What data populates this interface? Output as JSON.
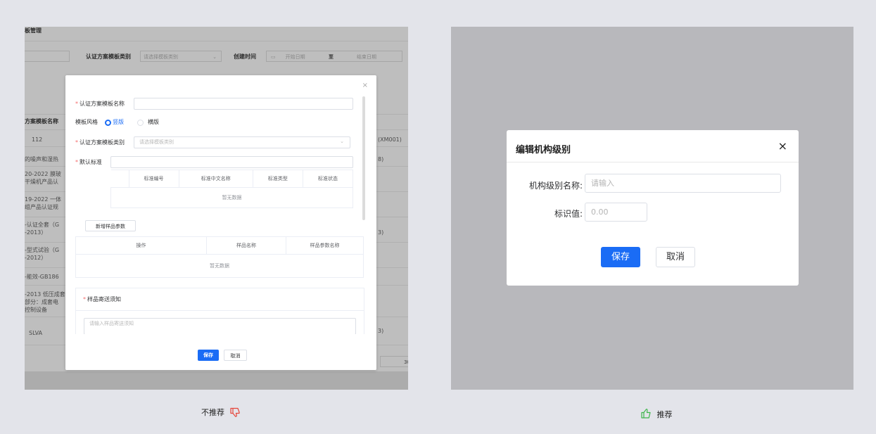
{
  "left_bg": {
    "page_title": "板管理",
    "filter_category_label": "认证方案模板类别",
    "filter_category_placeholder": "请选择模板类别",
    "filter_created_label": "创建时间",
    "filter_start_placeholder": "开始日期",
    "filter_to": "至",
    "filter_end_placeholder": "结束日期",
    "col_name_header": "方案模板名称",
    "rows": [
      "112",
      "的噪声和湿热",
      "20-2022 膜玻",
      "干燥机产品认",
      "19-2022 一体",
      "组产品认证规",
      "-认证全套（G",
      "-2013）",
      "-型式试验（G",
      "-2012）",
      "-能效-GB186",
      "-2013 低压成套",
      "部分：成套电",
      "控制设备",
      "SLVA"
    ],
    "right_cells": [
      "(XM001)",
      "8)",
      "3)",
      "3)"
    ],
    "page_size": "30"
  },
  "small_dialog": {
    "close_glyph": "×",
    "name_label": "认证方案模板名称",
    "style_label": "模板风格",
    "style_portrait": "竖版",
    "style_landscape": "横版",
    "category_label": "认证方案模板类别",
    "category_placeholder": "请选择模板类别",
    "default_std_label": "默认标准",
    "std_headers": [
      "标准编号",
      "标准中文名称",
      "标准类型",
      "标准状态"
    ],
    "std_empty": "暂无数据",
    "add_sample_btn": "新增样品参数",
    "sample_headers": [
      "操作",
      "样品名称",
      "样品参数名称"
    ],
    "sample_empty": "暂无数据",
    "notice_label": "样品寄送须知",
    "notice_placeholder": "请输入样品寄送须知",
    "save": "保存",
    "cancel": "取消"
  },
  "big_dialog": {
    "title": "编辑机构级别",
    "close_glyph": "×",
    "name_label": "机构级别名称:",
    "name_placeholder": "请输入",
    "id_label": "标识值:",
    "id_value": "0.00",
    "save": "保存",
    "cancel": "取消"
  },
  "captions": {
    "left": "不推荐",
    "right": "推荐"
  },
  "colors": {
    "primary": "#1a6cf5",
    "required": "#f56c6c",
    "thumb_down": "#e5453a",
    "thumb_up": "#3cb54a"
  }
}
